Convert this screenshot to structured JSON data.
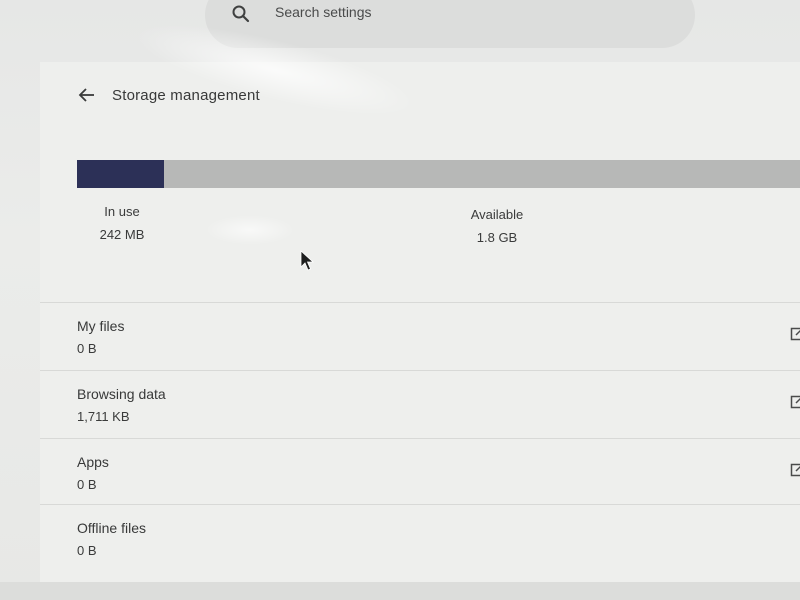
{
  "search": {
    "placeholder": "Search settings",
    "icon": "search-icon"
  },
  "header": {
    "title": "Storage management",
    "back_icon": "arrow-back-icon"
  },
  "usage": {
    "used_fraction": 0.12,
    "in_use_label": "In use",
    "in_use_value": "242 MB",
    "available_label": "Available",
    "available_value": "1.8 GB",
    "used_color": "#2c3057",
    "track_color": "#b7b8b7"
  },
  "items": [
    {
      "label": "My files",
      "value": "0 B",
      "icon": "open-external-icon"
    },
    {
      "label": "Browsing data",
      "value": "1,711 KB",
      "icon": "open-external-icon"
    },
    {
      "label": "Apps",
      "value": "0 B",
      "icon": "open-external-icon"
    },
    {
      "label": "Offline files",
      "value": "0 B"
    }
  ]
}
